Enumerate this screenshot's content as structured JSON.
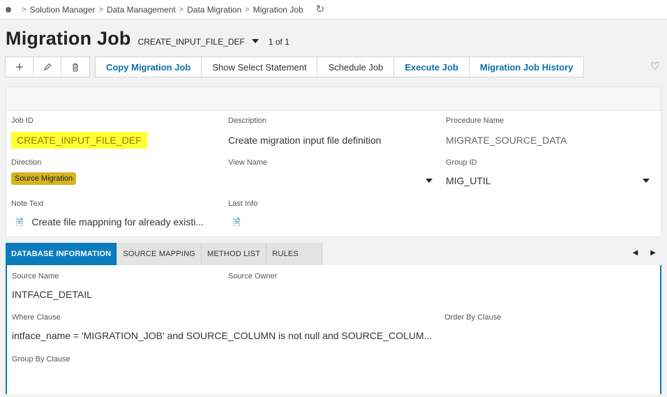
{
  "breadcrumb": {
    "items": [
      "Solution Manager",
      "Data Management",
      "Data Migration",
      "Migration Job"
    ]
  },
  "header": {
    "title": "Migration Job",
    "record_key": "CREATE_INPUT_FILE_DEF",
    "record_count": "1 of 1"
  },
  "toolbar": {
    "icons": [
      "plus-icon",
      "pencil-icon",
      "trash-icon"
    ],
    "actions": [
      {
        "label": "Copy Migration Job",
        "primary": true
      },
      {
        "label": "Show Select Statement",
        "primary": false
      },
      {
        "label": "Schedule Job",
        "primary": false
      },
      {
        "label": "Execute Job",
        "primary": true
      },
      {
        "label": "Migration Job History",
        "primary": true
      }
    ]
  },
  "form": {
    "job_id": {
      "label": "Job ID",
      "value": "CREATE_INPUT_FILE_DEF"
    },
    "description": {
      "label": "Description",
      "value": "Create migration input file definition"
    },
    "procedure_name": {
      "label": "Procedure Name",
      "value": "MIGRATE_SOURCE_DATA"
    },
    "direction": {
      "label": "Direction",
      "value": "Source Migration"
    },
    "view_name": {
      "label": "View Name",
      "value": ""
    },
    "group_id": {
      "label": "Group ID",
      "value": "MIG_UTIL"
    },
    "note_text": {
      "label": "Note Text",
      "value": "Create file mappning for already existi..."
    },
    "last_info": {
      "label": "Last Info",
      "value": ""
    }
  },
  "tabs": [
    {
      "label": "DATABASE INFORMATION",
      "active": true
    },
    {
      "label": "SOURCE MAPPING",
      "active": false
    },
    {
      "label": "METHOD LIST",
      "active": false
    },
    {
      "label": "RULES",
      "active": false
    }
  ],
  "database_info": {
    "source_name": {
      "label": "Source Name",
      "value": "INTFACE_DETAIL"
    },
    "source_owner": {
      "label": "Source Owner",
      "value": ""
    },
    "where_clause": {
      "label": "Where Clause",
      "value": "intface_name = 'MIGRATION_JOB' and SOURCE_COLUMN is not null and SOURCE_COLUM..."
    },
    "order_by_clause": {
      "label": "Order By Clause",
      "value": ""
    },
    "group_by_clause": {
      "label": "Group By Clause",
      "value": ""
    }
  },
  "colors": {
    "accent": "#0a7bbd",
    "link": "#0a6fa8",
    "highlight": "#ffff33",
    "badge": "#d4b520"
  }
}
